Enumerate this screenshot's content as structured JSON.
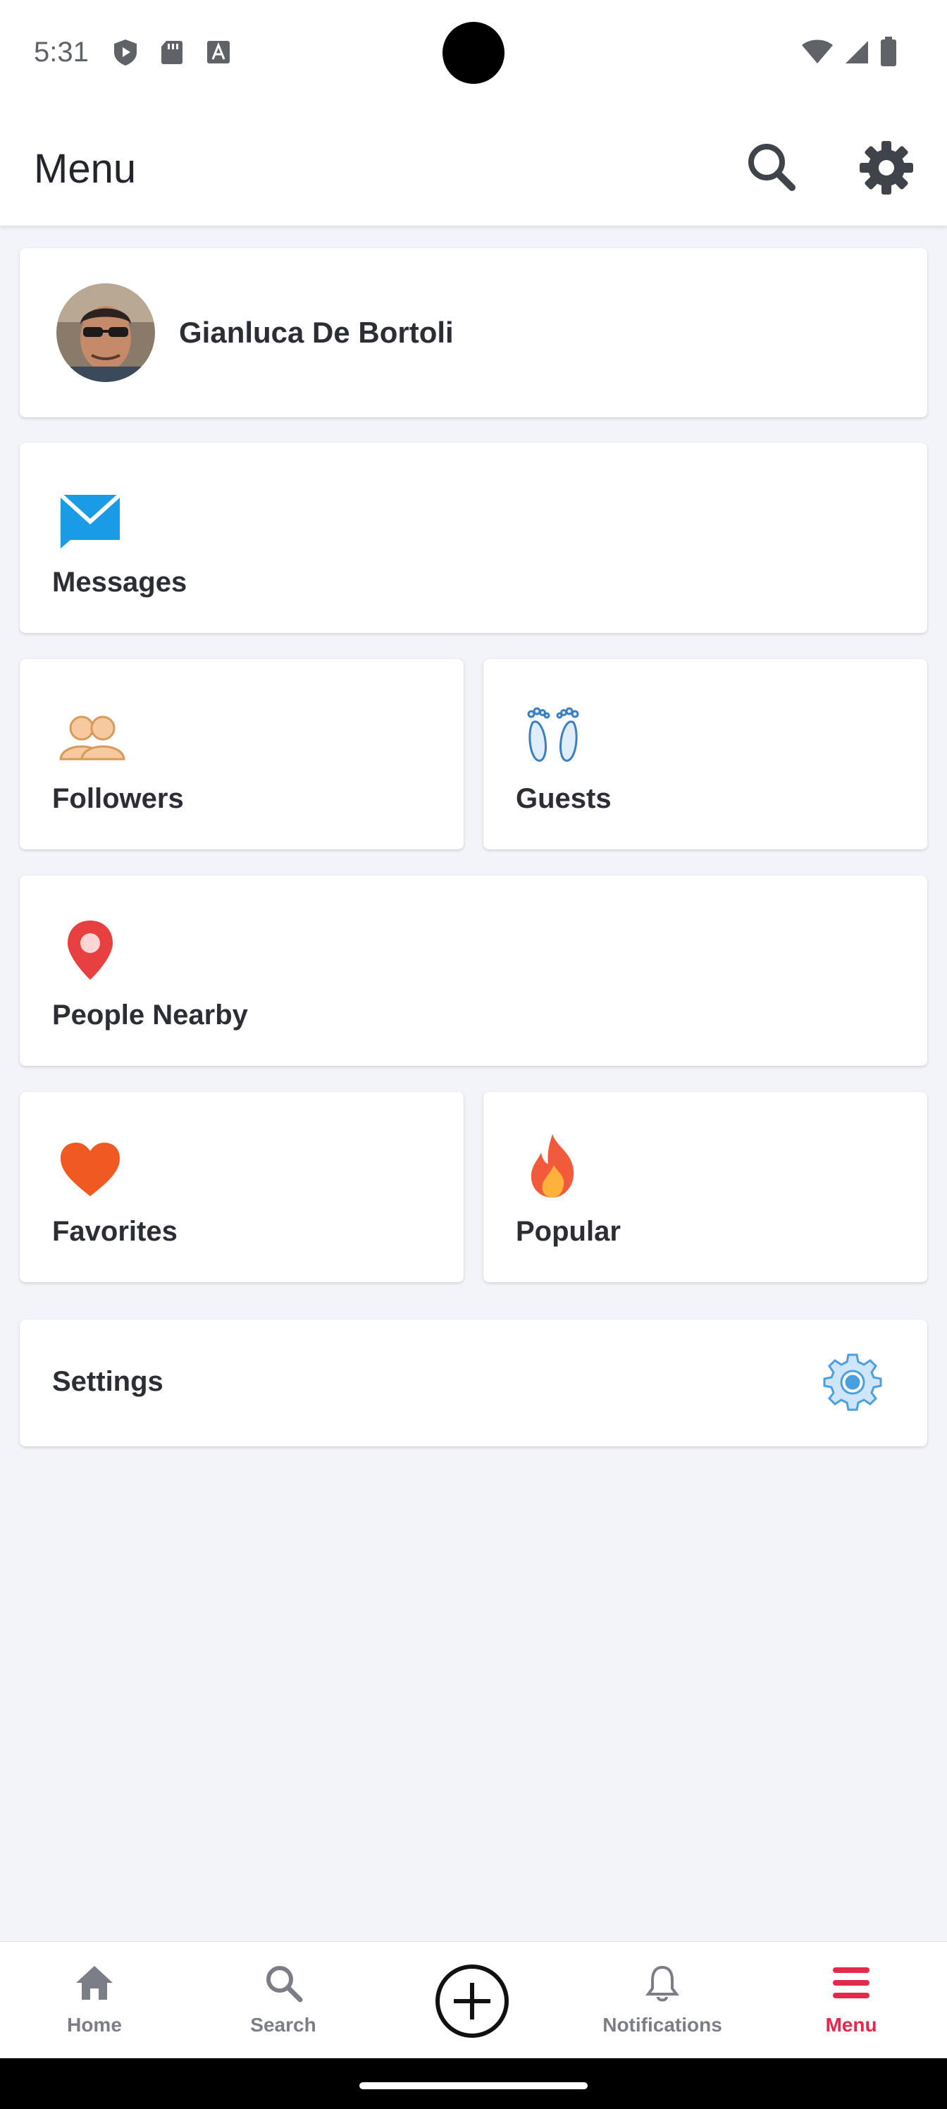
{
  "status_bar": {
    "time": "5:31"
  },
  "app_bar": {
    "title": "Menu"
  },
  "profile": {
    "name": "Gianluca De Bortoli"
  },
  "menu": {
    "messages": "Messages",
    "followers": "Followers",
    "guests": "Guests",
    "people_nearby": "People Nearby",
    "favorites": "Favorites",
    "popular": "Popular",
    "settings": "Settings"
  },
  "bottom_nav": {
    "items": [
      {
        "label": "Home",
        "icon": "home-icon"
      },
      {
        "label": "Search",
        "icon": "search-icon"
      },
      {
        "label": "",
        "icon": "add-circle-icon"
      },
      {
        "label": "Notifications",
        "icon": "bell-icon"
      },
      {
        "label": "Menu",
        "icon": "hamburger-icon",
        "active": true
      }
    ]
  },
  "colors": {
    "accent": "#e5284b",
    "messages_icon": "#1a9be6",
    "location_pin": "#e84040",
    "heart": "#f05a22",
    "settings_gear": "#4a9fe0"
  }
}
